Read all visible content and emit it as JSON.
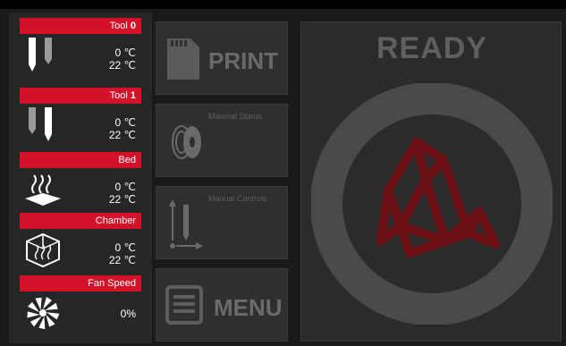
{
  "sidebar": {
    "items": [
      {
        "id": "tool0",
        "label": "Tool ",
        "label_suffix": "0",
        "icon": "nozzle-icon",
        "values": [
          "0 ℃",
          "22 ℃"
        ]
      },
      {
        "id": "tool1",
        "label": "Tool ",
        "label_suffix": "1",
        "icon": "nozzle-icon",
        "values": [
          "0 ℃",
          "22 ℃"
        ]
      },
      {
        "id": "bed",
        "label": "Bed",
        "label_suffix": "",
        "icon": "bed-heat-icon",
        "values": [
          "0 ℃",
          "22 ℃"
        ]
      },
      {
        "id": "chamber",
        "label": "Chamber",
        "label_suffix": "",
        "icon": "chamber-icon",
        "values": [
          "0 ℃",
          "22 ℃"
        ]
      },
      {
        "id": "fan",
        "label": "Fan Speed",
        "label_suffix": "",
        "icon": "fan-icon",
        "values": [
          "0%"
        ]
      }
    ]
  },
  "middle": {
    "print_label": "PRINT",
    "material_label": "Material Status",
    "manual_label": "Manual Controls",
    "menu_label": "MENU"
  },
  "right": {
    "status_text": "READY"
  },
  "colors": {
    "accent": "#d3122a",
    "logo": "#6b0f14",
    "ring": "#4a4a4a"
  }
}
